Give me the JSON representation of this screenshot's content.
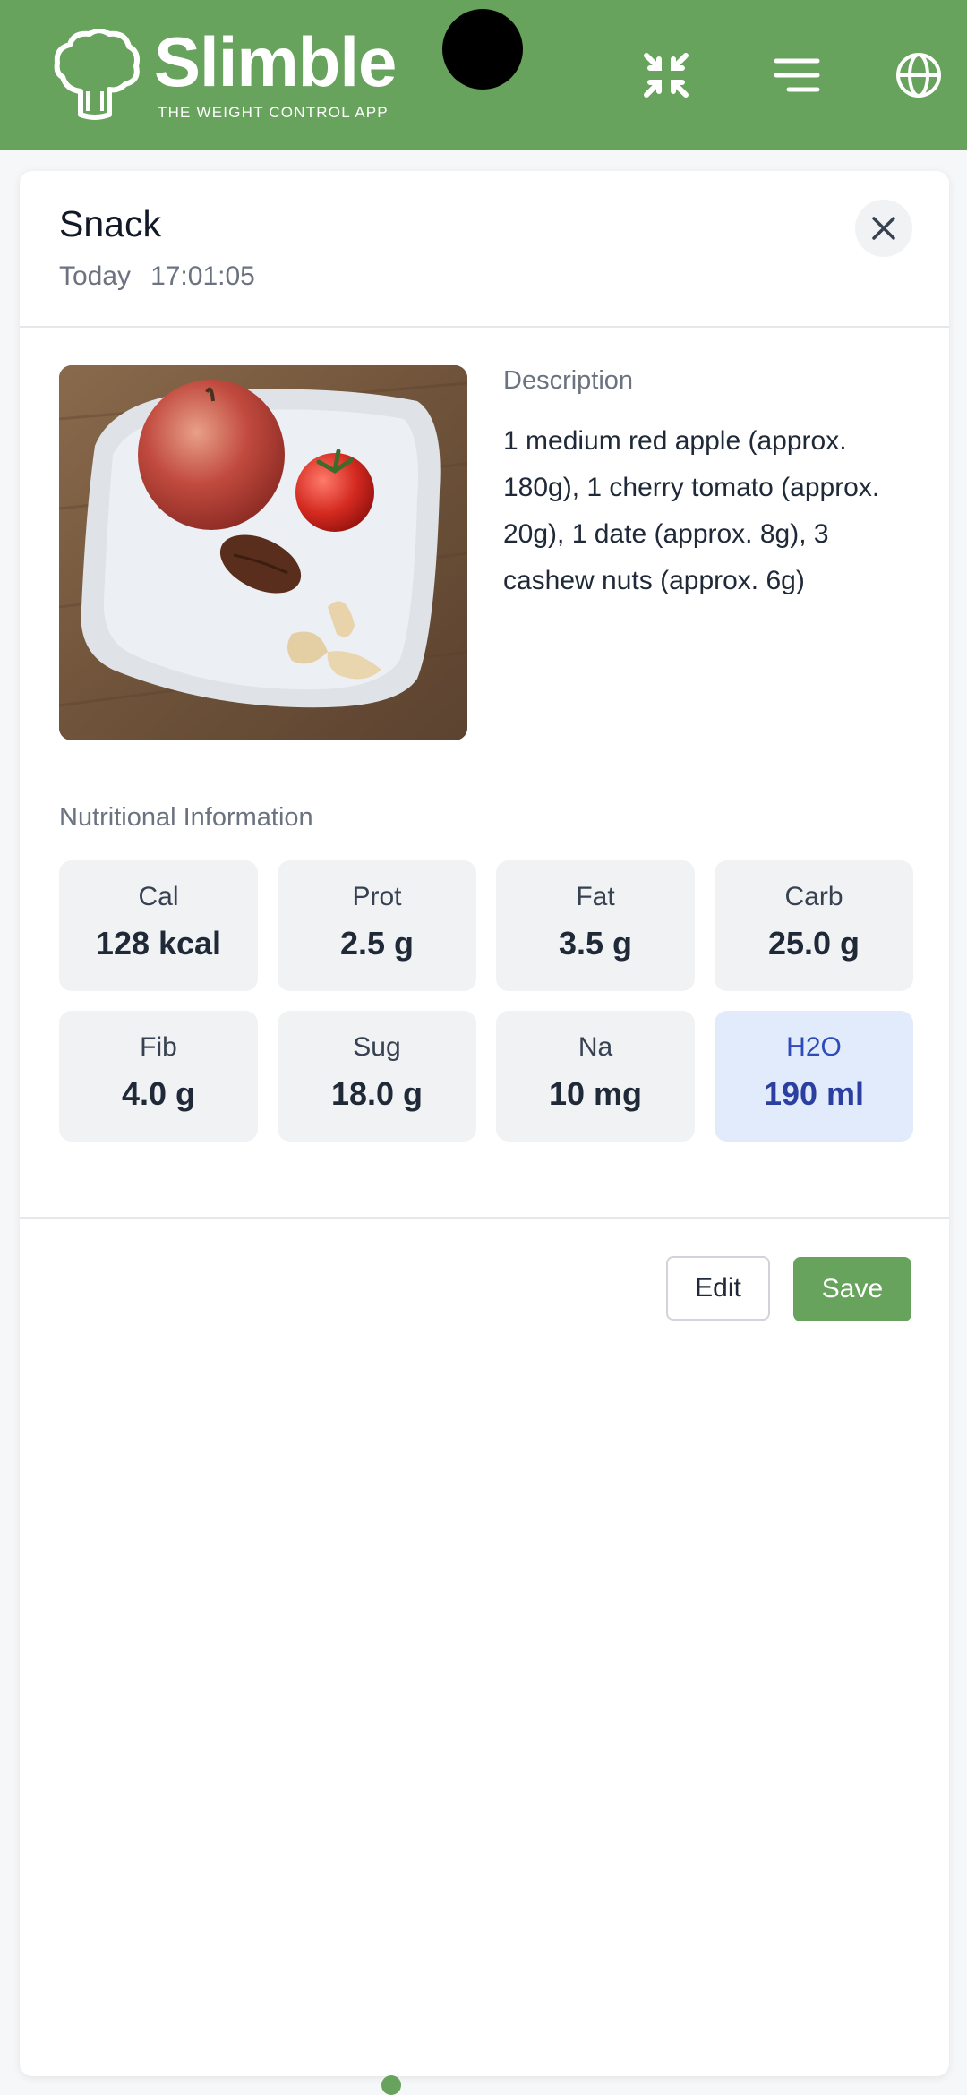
{
  "header": {
    "brand_name": "Slimble",
    "brand_tagline": "THE WEIGHT CONTROL APP",
    "actions": [
      {
        "icon": "compress-icon"
      },
      {
        "icon": "menu-icon"
      },
      {
        "icon": "globe-icon"
      }
    ],
    "color": "#67a35c"
  },
  "modal": {
    "title": "Snack",
    "date_label": "Today",
    "time": "17:01:05",
    "description_label": "Description",
    "description": "1 medium red apple (approx. 180g), 1 cherry tomato (approx. 20g), 1 date (approx. 8g), 3 cashew nuts (approx. 6g)",
    "nutrition_label": "Nutritional Information",
    "nutrition": [
      {
        "label": "Cal",
        "value": "128 kcal"
      },
      {
        "label": "Prot",
        "value": "2.5 g"
      },
      {
        "label": "Fat",
        "value": "3.5 g"
      },
      {
        "label": "Carb",
        "value": "25.0 g"
      },
      {
        "label": "Fib",
        "value": "4.0 g"
      },
      {
        "label": "Sug",
        "value": "18.0 g"
      },
      {
        "label": "Na",
        "value": "10 mg"
      },
      {
        "label": "H2O",
        "value": "190 ml"
      }
    ],
    "edit_label": "Edit",
    "save_label": "Save"
  }
}
